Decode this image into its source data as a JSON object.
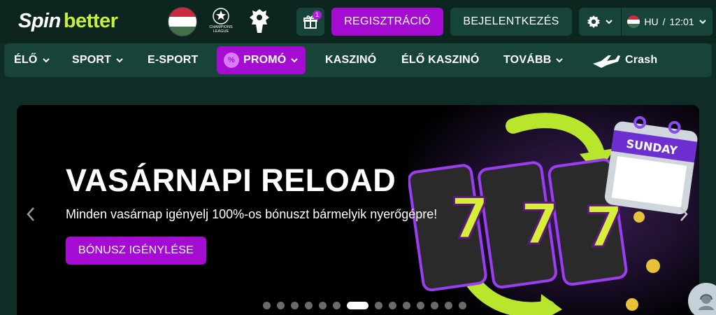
{
  "header": {
    "logo_part1": "Spin",
    "logo_part2": "better",
    "ucl_label": "CHAMPIONS LEAGUE",
    "gift_count": "1",
    "register_label": "REGISZTRÁCIÓ",
    "login_label": "BEJELENTKEZÉS",
    "lang_code": "HU",
    "separator": "/",
    "time": "12:01"
  },
  "nav": {
    "items": [
      {
        "label": "ÉLŐ",
        "dropdown": true
      },
      {
        "label": "SPORT",
        "dropdown": true
      },
      {
        "label": "E-SPORT",
        "dropdown": false
      },
      {
        "label": "PROMÓ",
        "dropdown": true,
        "badge": "%"
      },
      {
        "label": "KASZINÓ",
        "dropdown": false
      },
      {
        "label": "ÉLŐ KASZINÓ",
        "dropdown": false
      },
      {
        "label": "TOVÁBB",
        "dropdown": true
      },
      {
        "label": "Crash",
        "dropdown": false
      }
    ]
  },
  "banner": {
    "title": "VASÁRNAPI RELOAD",
    "subtitle": "Minden vasárnap igényelj 100%-os bónuszt bármelyik nyerőgépre!",
    "cta_label": "BÓNUSZ IGÉNYLÉSE",
    "calendar_day": "SUNDAY",
    "reel_symbols": [
      "7",
      "7",
      "7"
    ],
    "slide_count": 14,
    "active_slide": 7
  },
  "colors": {
    "accent_purple": "#a50cd2",
    "brand_lime": "#c8f03a",
    "header_bg": "#0c251f",
    "nav_bg": "#184338",
    "button_bg": "#17443a",
    "flag_red": "#cd2a3e",
    "flag_white": "#ffffff",
    "flag_green": "#436f4d"
  },
  "icons": {
    "gift": "gift-icon",
    "settings": "gear-icon",
    "chevron": "chevron-down-icon",
    "arrow_prev": "chevron-left-icon",
    "arrow_next": "chevron-right-icon",
    "support": "support-agent-icon",
    "crash": "airplane-icon"
  }
}
